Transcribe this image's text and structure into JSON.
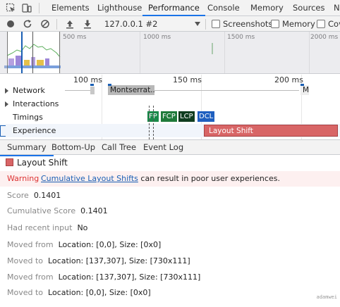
{
  "tabs": [
    "Elements",
    "Lighthouse",
    "Performance",
    "Console",
    "Memory",
    "Sources",
    "N"
  ],
  "active_tab": "Performance",
  "toolbar": {
    "profile_select": "127.0.0.1 #2",
    "screenshots_label": "Screenshots",
    "memory_label": "Memory",
    "coverage_label": "Cov"
  },
  "overview": {
    "ticks": [
      "500 ms",
      "1000 ms",
      "1500 ms",
      "2000 ms"
    ]
  },
  "flamechart": {
    "ticks": [
      "100 ms",
      "150 ms",
      "200 ms"
    ],
    "rows": {
      "network": "Network",
      "interactions": "Interactions",
      "timings": "Timings",
      "experience": "Experience"
    },
    "network_items": [
      "Montserrat...",
      "M"
    ],
    "markers": {
      "fp": "FP",
      "fcp": "FCP",
      "lcp": "LCP",
      "dcl": "DCL",
      "fp_color": "#1a8a4a",
      "fcp_color": "#1f7a3a",
      "lcp_color": "#0f3d1f",
      "dcl_color": "#1f5fbf"
    },
    "layout_shift_label": "Layout Shift"
  },
  "subtabs": [
    "Summary",
    "Bottom-Up",
    "Call Tree",
    "Event Log"
  ],
  "active_subtab": "Summary",
  "details": {
    "title": "Layout Shift",
    "warning_label": "Warning",
    "warning_link": "Cumulative Layout Shifts",
    "warning_text": "can result in poor user experiences.",
    "score_label": "Score",
    "score_value": "0.1401",
    "cumulative_label": "Cumulative Score",
    "cumulative_value": "0.1401",
    "input_label": "Had recent input",
    "input_value": "No",
    "moved_from_1_label": "Moved from",
    "moved_from_1_value": "Location: [0,0], Size: [0x0]",
    "moved_to_1_label": "Moved to",
    "moved_to_1_value": "Location: [137,307], Size: [730x111]",
    "moved_from_2_label": "Moved from",
    "moved_from_2_value": "Location: [137,307], Size: [730x111]",
    "moved_to_2_label": "Moved to",
    "moved_to_2_value": "Location: [0,0], Size: [0x0]"
  },
  "watermark": "adamwei"
}
